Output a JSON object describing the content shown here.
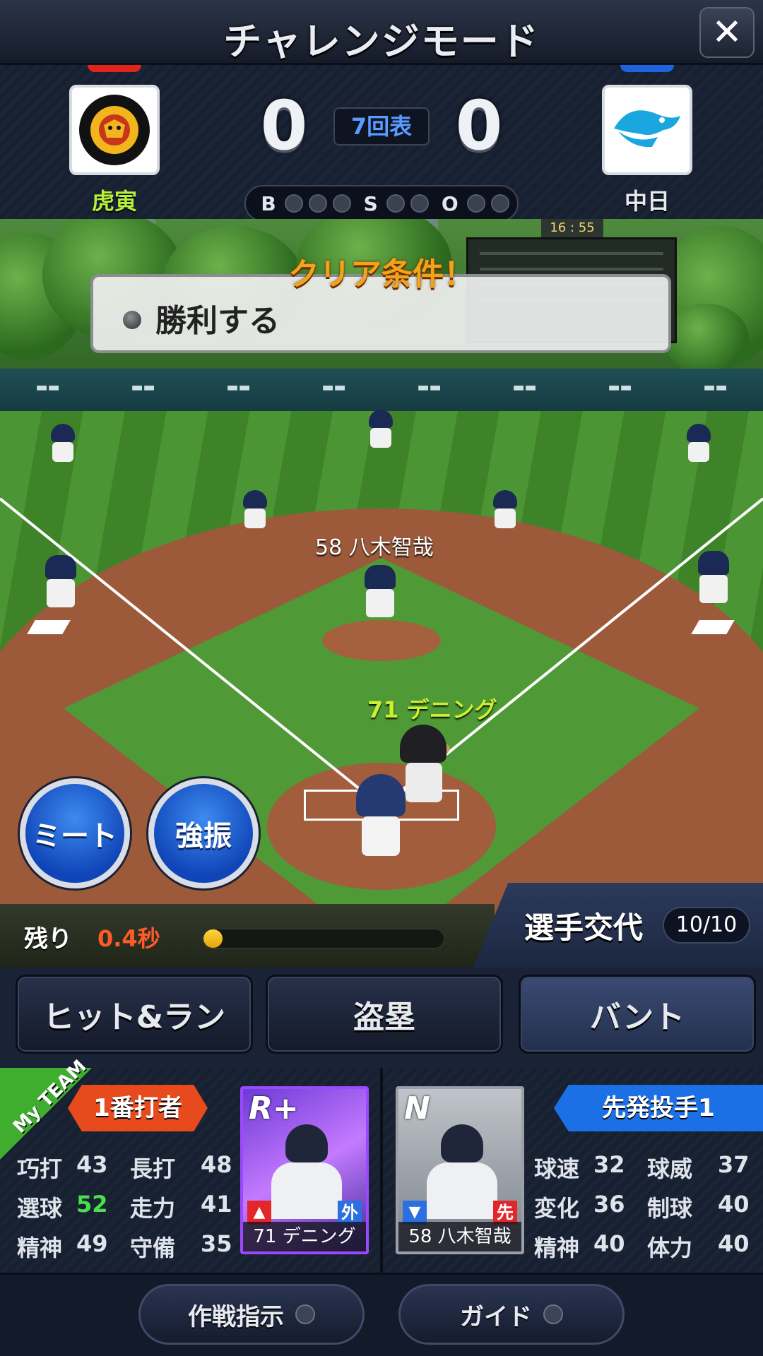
{
  "header": {
    "title": "チャレンジモード",
    "close_icon": "close-icon"
  },
  "scoreboard": {
    "home": {
      "name": "虎寅",
      "score": "0",
      "logo_text": "HANSHIN Tigers",
      "color": "#e0241b"
    },
    "away": {
      "name": "中日",
      "score": "0",
      "logo_text": "Dragons",
      "color": "#1c63e0"
    },
    "inning": "7回表",
    "count": {
      "b_label": "B",
      "s_label": "S",
      "o_label": "O"
    }
  },
  "stadium": {
    "clock": "16 : 55"
  },
  "clear_condition": {
    "title": "クリア条件！",
    "item": "勝利する"
  },
  "field": {
    "pitcher_label": "58 八木智哉",
    "batter_label": "71 デニング"
  },
  "swing_buttons": {
    "meet": "ミート",
    "power": "強振"
  },
  "timer": {
    "label": "残り",
    "value": "0.4秒",
    "progress": 0.08
  },
  "substitution": {
    "label": "選手交代",
    "count": "10/10"
  },
  "tactics": {
    "hit_and_run": "ヒット&ラン",
    "steal": "盗塁",
    "bunt": "バント"
  },
  "batter_panel": {
    "badge": "My TEAM",
    "role": "1番打者",
    "stats": [
      {
        "label": "巧打",
        "value": "43"
      },
      {
        "label": "長打",
        "value": "48"
      },
      {
        "label": "選球",
        "value": "52"
      },
      {
        "label": "走力",
        "value": "41"
      },
      {
        "label": "精神",
        "value": "49"
      },
      {
        "label": "守備",
        "value": "35"
      }
    ],
    "card": {
      "rarity": "R+",
      "badge_left": "▲",
      "badge_right": "外",
      "name": "71 デニング"
    }
  },
  "pitcher_panel": {
    "role": "先発投手1",
    "stats": [
      {
        "label": "球速",
        "value": "32"
      },
      {
        "label": "球威",
        "value": "37"
      },
      {
        "label": "変化",
        "value": "36"
      },
      {
        "label": "制球",
        "value": "40"
      },
      {
        "label": "精神",
        "value": "40"
      },
      {
        "label": "体力",
        "value": "40"
      }
    ],
    "card": {
      "rarity": "N",
      "badge_left": "▼",
      "badge_right": "先",
      "name": "58 八木智哉"
    }
  },
  "footer": {
    "strategy": "作戦指示",
    "guide": "ガイド"
  }
}
